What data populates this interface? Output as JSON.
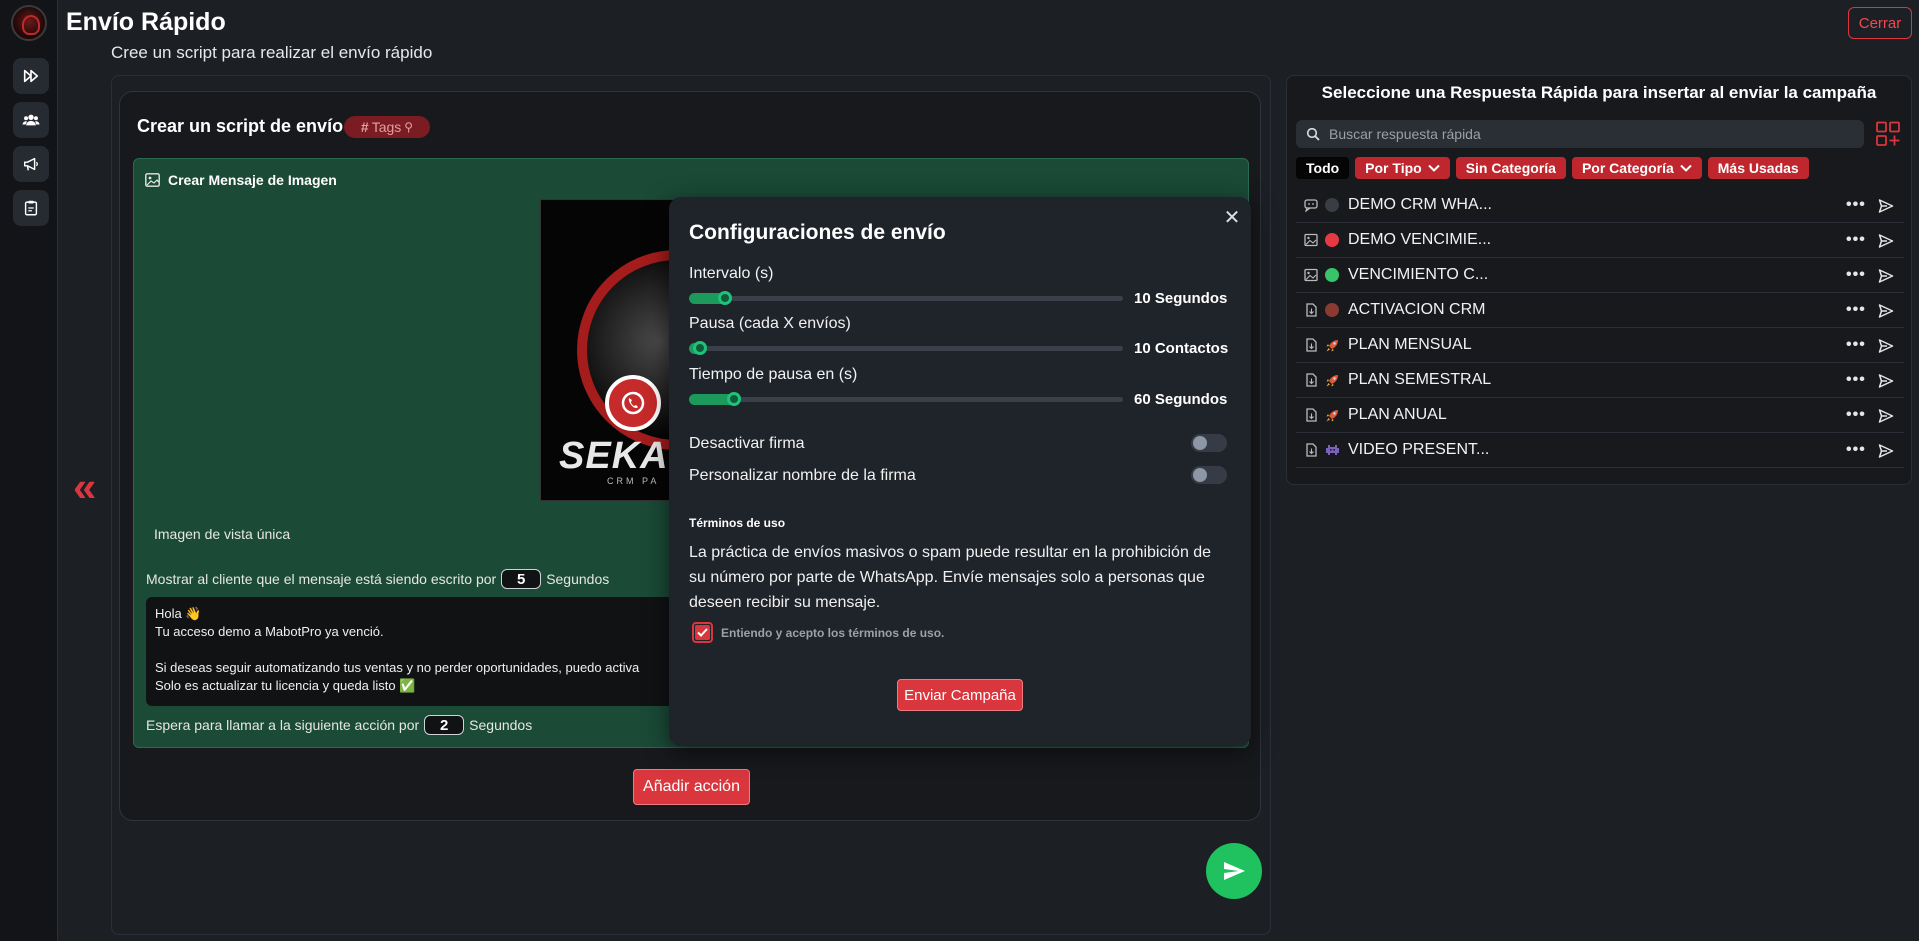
{
  "header": {
    "title": "Envío Rápido",
    "subtitle": "Cree un script para realizar el envío rápido",
    "close_label": "Cerrar"
  },
  "rail": {
    "items": [
      "fast-forward-icon",
      "users-icon",
      "megaphone-icon",
      "clipboard-icon"
    ]
  },
  "script": {
    "title": "Crear un script de envío",
    "tags_label": "Tags",
    "image_message_title": "Crear Mensaje de Imagen",
    "preview_brand": "SEKA",
    "preview_brand_sub": "CRM PA",
    "single_view_label": "Imagen de vista única",
    "typing_prefix": "Mostrar al cliente que el mensaje está siendo escrito por",
    "typing_seconds": "5",
    "typing_suffix": "Segundos",
    "message_body": "Hola 👋\nTu acceso demo a MabotPro ya venció.\n\nSi deseas seguir automatizando tus ventas y no perder oportunidades, puedo activa\nSolo es actualizar tu licencia y queda listo ✅",
    "wait_prefix": "Espera para llamar a la siguiente acción por",
    "wait_seconds": "2",
    "wait_suffix": "Segundos",
    "add_action_label": "Añadir acción"
  },
  "modal": {
    "title": "Configuraciones de envío",
    "sliders": [
      {
        "label": "Intervalo (s)",
        "value_text": "10 Segundos",
        "fraction": 0.09
      },
      {
        "label": "Pausa (cada X envíos)",
        "value_text": "10 Contactos",
        "fraction": 0.02
      },
      {
        "label": "Tiempo de pausa en (s)",
        "value_text": "60 Segundos",
        "fraction": 0.11
      }
    ],
    "toggles": [
      {
        "label": "Desactivar firma",
        "on": false
      },
      {
        "label": "Personalizar nombre de la firma",
        "on": false
      }
    ],
    "terms_title": "Términos de uso",
    "terms_body": "La práctica de envíos masivos o spam puede resultar en la prohibición de su número por parte de WhatsApp. Envíe mensajes solo a personas que deseen recibir su mensaje.",
    "accept_label": "Entiendo y acepto los términos de uso.",
    "accept_checked": true,
    "send_label": "Enviar Campaña"
  },
  "quick_replies": {
    "title": "Seleccione una Respuesta Rápida para insertar al enviar la campaña",
    "search_placeholder": "Buscar respuesta rápida",
    "filters": [
      {
        "label": "Todo",
        "active": true,
        "dropdown": false
      },
      {
        "label": "Por Tipo",
        "active": false,
        "dropdown": true
      },
      {
        "label": "Sin Categoría",
        "active": false,
        "dropdown": false
      },
      {
        "label": "Por Categoría",
        "active": false,
        "dropdown": true
      },
      {
        "label": "Más Usadas",
        "active": false,
        "dropdown": false
      }
    ],
    "items": [
      {
        "type_icon": "chat-icon",
        "marker": "dot",
        "color": "#3a3d44",
        "name": "DEMO CRM WHA..."
      },
      {
        "type_icon": "image-icon",
        "marker": "dot",
        "color": "#e53945",
        "name": "DEMO VENCIMIE..."
      },
      {
        "type_icon": "image-icon",
        "marker": "dot",
        "color": "#37c46b",
        "name": "VENCIMIENTO C..."
      },
      {
        "type_icon": "file-icon",
        "marker": "dot",
        "color": "#8a3a30",
        "name": "ACTIVACION CRM"
      },
      {
        "type_icon": "file-icon",
        "marker": "rocket",
        "color": "#e05a3a",
        "name": "PLAN MENSUAL"
      },
      {
        "type_icon": "file-icon",
        "marker": "rocket",
        "color": "#e05a3a",
        "name": "PLAN SEMESTRAL"
      },
      {
        "type_icon": "file-icon",
        "marker": "rocket",
        "color": "#e05a3a",
        "name": "PLAN ANUAL"
      },
      {
        "type_icon": "file-icon",
        "marker": "invader",
        "color": "#7b61b8",
        "name": "VIDEO PRESENT..."
      }
    ]
  },
  "colors": {
    "accent_red": "#d9363e",
    "accent_green": "#1fc25e",
    "card_green": "#1b4a37",
    "background": "#1c1f24"
  }
}
